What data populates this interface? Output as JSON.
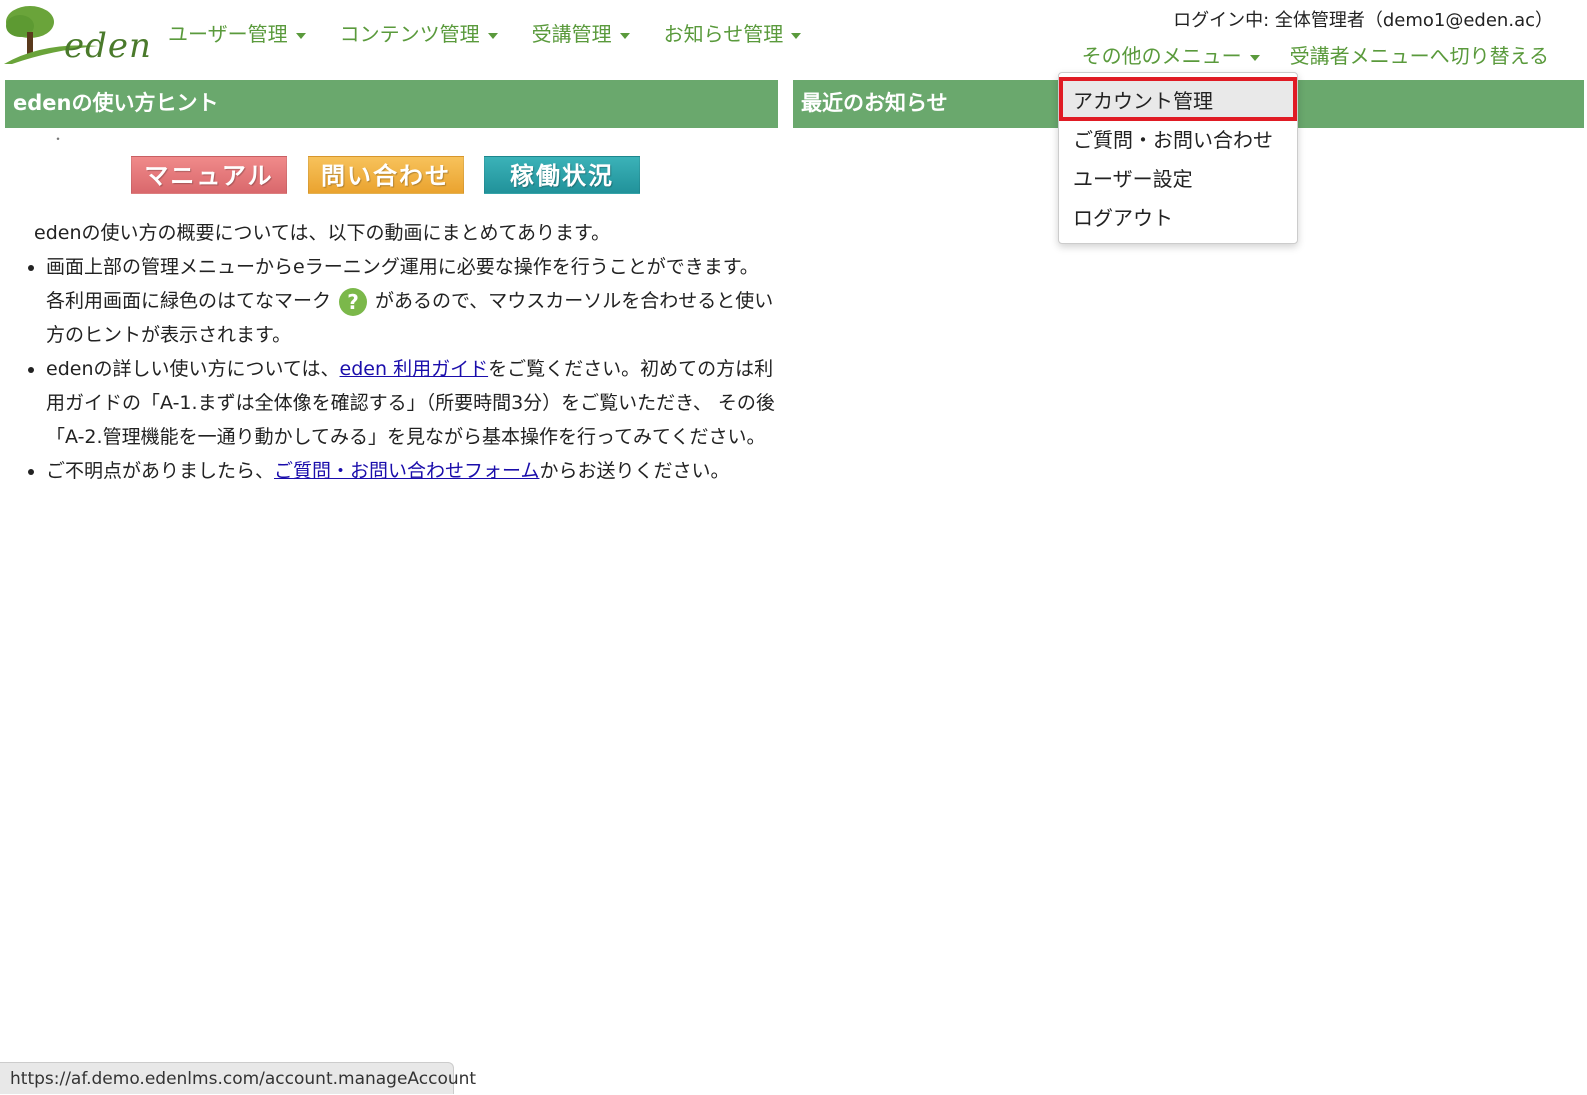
{
  "brand": {
    "logo_text": "eden"
  },
  "nav": {
    "items": [
      {
        "label": "ユーザー管理"
      },
      {
        "label": "コンテンツ管理"
      },
      {
        "label": "受講管理"
      },
      {
        "label": "お知らせ管理"
      }
    ],
    "login_info": "ログイン中: 全体管理者（demo1@eden.ac）",
    "other_menu": "その他のメニュー",
    "switch_label": "受講者メニューへ切り替える"
  },
  "left_panel": {
    "title": "edenの使い方ヒント",
    "dot": "・",
    "buttons": [
      "マニュアル",
      "問い合わせ",
      "稼働状況"
    ],
    "intro": "edenの使い方の概要については、以下の動画にまとめてあります。",
    "bullet1_a": "画面上部の管理メニューからeラーニング運用に必要な操作を行うことができます。各利用画面に緑色のはてなマーク",
    "bullet1_icon": "?",
    "bullet1_b": "があるので、マウスカーソルを合わせると使い方のヒントが表示されます。",
    "bullet2_a": "edenの詳しい使い方については、",
    "bullet2_link": "eden 利用ガイド",
    "bullet2_b": "をご覧ください。初めての方は利用ガイドの「A-1.まずは全体像を確認する」（所要時間3分）をご覧いただき、 その後「A-2.管理機能を一通り動かしてみる」を見ながら基本操作を行ってみてください。",
    "bullet3_a": "ご不明点がありましたら、",
    "bullet3_link": "ご質問・お問い合わせフォーム",
    "bullet3_b": "からお送りください。"
  },
  "right_panel": {
    "title": "最近のお知らせ"
  },
  "dropdown": {
    "items": [
      "アカウント管理",
      "ご質問・お問い合わせ",
      "ユーザー設定",
      "ログアウト"
    ],
    "highlighted_index": 0,
    "highlight_color": "#e01b24"
  },
  "status_bar": {
    "url": "https://af.demo.edenlms.com/account.manageAccount"
  },
  "colors": {
    "brand_green": "#5a9a3c",
    "panel_header": "#6aa86d",
    "link": "#1a0dab"
  }
}
